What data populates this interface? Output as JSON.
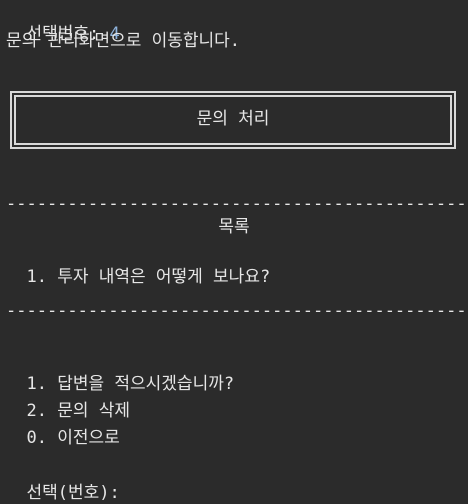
{
  "terminal": {
    "selection_label": "선택번호: ",
    "selection_value": "4",
    "navigate_message": "문의 관리화면으로 이동합니다.",
    "box_title": "문의 처리",
    "divider": "------------------------------------------------------------------------------",
    "list_header": "목록",
    "inquiries": [
      {
        "num": "1.",
        "text": "투자 내역은 어떻게 보나요?"
      }
    ],
    "menu": [
      {
        "num": "1.",
        "text": "답변을 적으시겠습니까?"
      },
      {
        "num": "2.",
        "text": "문의 삭제"
      },
      {
        "num": "0.",
        "text": "이전으로"
      }
    ],
    "prompt": "선택(번호):"
  },
  "colors": {
    "background": "#2b2b2b",
    "text": "#e6e6e6",
    "number_accent": "#8fb4dd"
  }
}
